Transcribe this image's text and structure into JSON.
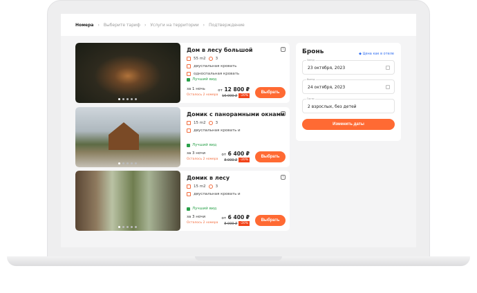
{
  "breadcrumb": [
    "Номера",
    "Выберите тариф",
    "Услуги на территории",
    "Подтверждение"
  ],
  "rooms": [
    {
      "title": "Дом в лесу большой",
      "area": "55 m2",
      "guests": "3",
      "beds": [
        "двуспальная кровать",
        "односпальная кровать"
      ],
      "best": "Лучший вид",
      "nights": "за 1 ночь",
      "left": "Осталось 2 номера",
      "price": "12 800 ₽",
      "price_prefix": "от",
      "old_price": "16 000 ₽",
      "discount": "-20%",
      "button": "Выбрать"
    },
    {
      "title": "Домик с панорамными окнами",
      "area": "15 m2",
      "guests": "3",
      "beds": [
        "двуспальная кровать и"
      ],
      "best": "Лучший вид",
      "nights": "за 3 ночи",
      "left": "Осталось 2 номера",
      "price": "6 400 ₽",
      "price_prefix": "от",
      "old_price": "8 000 ₽",
      "discount": "-20%",
      "button": "Выбрать"
    },
    {
      "title": "Домик в лесу",
      "area": "15 m2",
      "guests": "3",
      "beds": [
        "двуспальная кровать и"
      ],
      "best": "Лучший вид",
      "nights": "за 3 ночи",
      "left": "Осталось 2 номера",
      "price": "6 400 ₽",
      "price_prefix": "от",
      "old_price": "8 000 ₽",
      "discount": "-20%",
      "button": "Выбрать"
    }
  ],
  "booking": {
    "title": "Бронь",
    "link": "Цена как в отеле",
    "checkin_label": "Заезд",
    "checkin": "23 октября, 2023",
    "checkout_label": "Выезд",
    "checkout": "24 октября, 2023",
    "guests_label": "Гости",
    "guests": "2 взрослых, без детей",
    "button": "Изменить даты"
  }
}
